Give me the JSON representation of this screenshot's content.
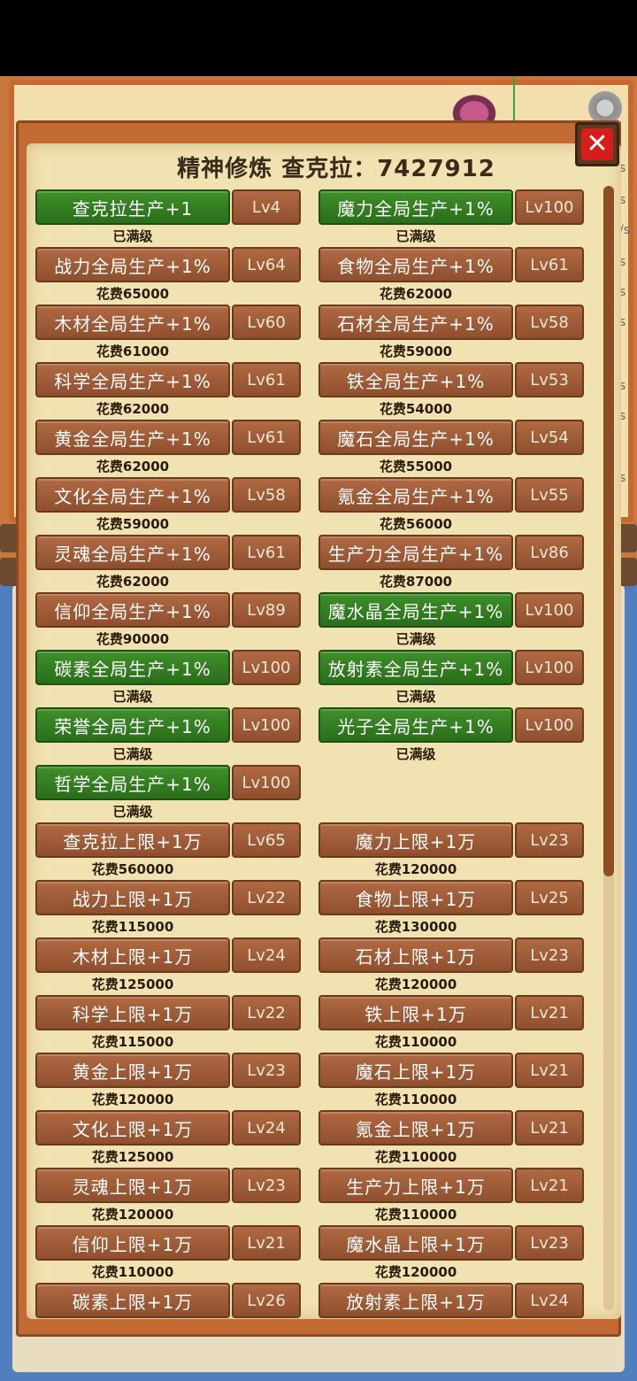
{
  "title": "精神修炼  查克拉：7427912",
  "close_label": "✕",
  "side_marks": [
    "s",
    "s",
    "/s",
    "s",
    "s",
    "s",
    "s",
    "s",
    "s"
  ],
  "upgrades": [
    {
      "name": "查克拉生产+1",
      "level": "Lv4",
      "cost": "已满级",
      "maxed": true
    },
    {
      "name": "魔力全局生产+1%",
      "level": "Lv100",
      "cost": "已满级",
      "maxed": true
    },
    {
      "name": "战力全局生产+1%",
      "level": "Lv64",
      "cost": "花费65000",
      "maxed": false
    },
    {
      "name": "食物全局生产+1%",
      "level": "Lv61",
      "cost": "花费62000",
      "maxed": false
    },
    {
      "name": "木材全局生产+1%",
      "level": "Lv60",
      "cost": "花费61000",
      "maxed": false
    },
    {
      "name": "石材全局生产+1%",
      "level": "Lv58",
      "cost": "花费59000",
      "maxed": false
    },
    {
      "name": "科学全局生产+1%",
      "level": "Lv61",
      "cost": "花费62000",
      "maxed": false
    },
    {
      "name": "铁全局生产+1%",
      "level": "Lv53",
      "cost": "花费54000",
      "maxed": false
    },
    {
      "name": "黄金全局生产+1%",
      "level": "Lv61",
      "cost": "花费62000",
      "maxed": false
    },
    {
      "name": "魔石全局生产+1%",
      "level": "Lv54",
      "cost": "花费55000",
      "maxed": false
    },
    {
      "name": "文化全局生产+1%",
      "level": "Lv58",
      "cost": "花费59000",
      "maxed": false
    },
    {
      "name": "氪金全局生产+1%",
      "level": "Lv55",
      "cost": "花费56000",
      "maxed": false
    },
    {
      "name": "灵魂全局生产+1%",
      "level": "Lv61",
      "cost": "花费62000",
      "maxed": false
    },
    {
      "name": "生产力全局生产+1%",
      "level": "Lv86",
      "cost": "花费87000",
      "maxed": false
    },
    {
      "name": "信仰全局生产+1%",
      "level": "Lv89",
      "cost": "花费90000",
      "maxed": false
    },
    {
      "name": "魔水晶全局生产+1%",
      "level": "Lv100",
      "cost": "已满级",
      "maxed": true
    },
    {
      "name": "碳素全局生产+1%",
      "level": "Lv100",
      "cost": "已满级",
      "maxed": true
    },
    {
      "name": "放射素全局生产+1%",
      "level": "Lv100",
      "cost": "已满级",
      "maxed": true
    },
    {
      "name": "荣誉全局生产+1%",
      "level": "Lv100",
      "cost": "已满级",
      "maxed": true
    },
    {
      "name": "光子全局生产+1%",
      "level": "Lv100",
      "cost": "已满级",
      "maxed": true
    },
    {
      "name": "哲学全局生产+1%",
      "level": "Lv100",
      "cost": "已满级",
      "maxed": true
    },
    null,
    {
      "name": "查克拉上限+1万",
      "level": "Lv65",
      "cost": "花费560000",
      "maxed": false
    },
    {
      "name": "魔力上限+1万",
      "level": "Lv23",
      "cost": "花费120000",
      "maxed": false
    },
    {
      "name": "战力上限+1万",
      "level": "Lv22",
      "cost": "花费115000",
      "maxed": false
    },
    {
      "name": "食物上限+1万",
      "level": "Lv25",
      "cost": "花费130000",
      "maxed": false
    },
    {
      "name": "木材上限+1万",
      "level": "Lv24",
      "cost": "花费125000",
      "maxed": false
    },
    {
      "name": "石材上限+1万",
      "level": "Lv23",
      "cost": "花费120000",
      "maxed": false
    },
    {
      "name": "科学上限+1万",
      "level": "Lv22",
      "cost": "花费115000",
      "maxed": false
    },
    {
      "name": "铁上限+1万",
      "level": "Lv21",
      "cost": "花费110000",
      "maxed": false
    },
    {
      "name": "黄金上限+1万",
      "level": "Lv23",
      "cost": "花费120000",
      "maxed": false
    },
    {
      "name": "魔石上限+1万",
      "level": "Lv21",
      "cost": "花费110000",
      "maxed": false
    },
    {
      "name": "文化上限+1万",
      "level": "Lv24",
      "cost": "花费125000",
      "maxed": false
    },
    {
      "name": "氪金上限+1万",
      "level": "Lv21",
      "cost": "花费110000",
      "maxed": false
    },
    {
      "name": "灵魂上限+1万",
      "level": "Lv23",
      "cost": "花费120000",
      "maxed": false
    },
    {
      "name": "生产力上限+1万",
      "level": "Lv21",
      "cost": "花费110000",
      "maxed": false
    },
    {
      "name": "信仰上限+1万",
      "level": "Lv21",
      "cost": "花费110000",
      "maxed": false
    },
    {
      "name": "魔水晶上限+1万",
      "level": "Lv23",
      "cost": "花费120000",
      "maxed": false
    },
    {
      "name": "碳素上限+1万",
      "level": "Lv26",
      "cost": "",
      "maxed": false
    },
    {
      "name": "放射素上限+1万",
      "level": "Lv24",
      "cost": "",
      "maxed": false
    }
  ],
  "icons": {
    "settings": "gear-icon",
    "close": "close-icon",
    "monster": "monster-icon"
  }
}
